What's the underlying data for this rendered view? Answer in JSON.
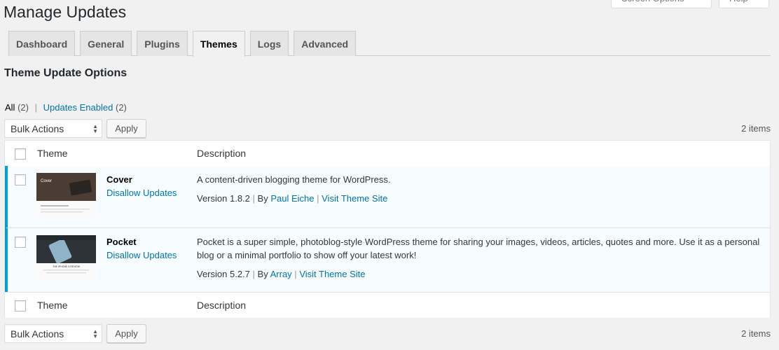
{
  "header": {
    "screen_options": "Screen Options",
    "help": "Help",
    "title": "Manage Updates"
  },
  "tabs": [
    {
      "label": "Dashboard"
    },
    {
      "label": "General"
    },
    {
      "label": "Plugins"
    },
    {
      "label": "Themes",
      "active": true
    },
    {
      "label": "Logs"
    },
    {
      "label": "Advanced"
    }
  ],
  "section_title": "Theme Update Options",
  "filters": {
    "all_label": "All",
    "all_count": "(2)",
    "separator": "|",
    "enabled_label": "Updates Enabled",
    "enabled_count": "(2)"
  },
  "tablenav": {
    "bulk_actions": "Bulk Actions",
    "apply": "Apply",
    "items": "2 items"
  },
  "columns": {
    "theme": "Theme",
    "description": "Description"
  },
  "rows": [
    {
      "name": "Cover",
      "action": "Disallow Updates",
      "description": "A content-driven blogging theme for WordPress.",
      "version": "Version 1.8.2",
      "by": "By",
      "author": "Paul Eiche",
      "site_link": "Visit Theme Site",
      "thumb_title": "Cover"
    },
    {
      "name": "Pocket",
      "action": "Disallow Updates",
      "description": "Pocket is a super simple, photoblog-style WordPress theme for sharing your images, videos, articles, quotes and more. Use it as a personal blog or a minimal portfolio to show off your latest work!",
      "version": "Version 5.2.7",
      "by": "By",
      "author": "Array",
      "site_link": "Visit Theme Site",
      "thumb_title": "THE IPHONE 6 REVIEW"
    }
  ],
  "colors": {
    "accent": "#0073aa",
    "active_row_border": "#00a0d2",
    "active_row_bg": "#f7fcfe"
  }
}
